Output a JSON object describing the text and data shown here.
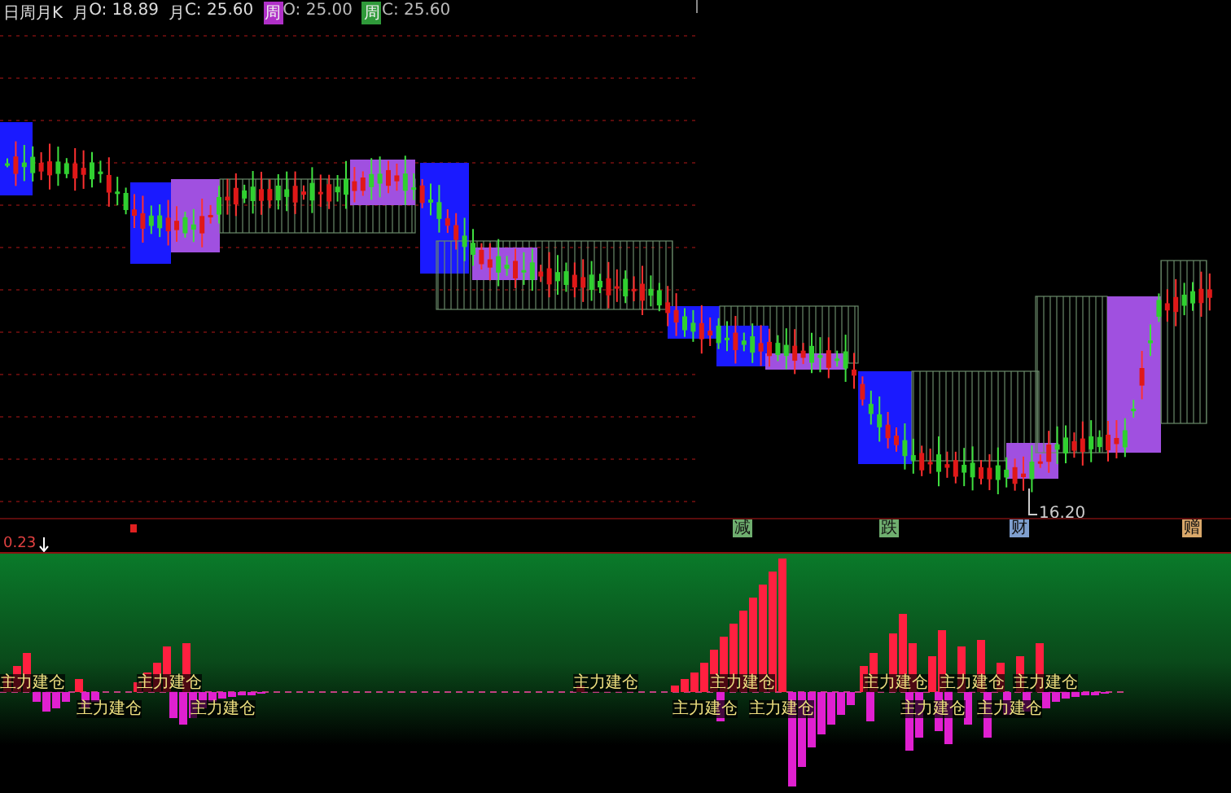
{
  "header": {
    "title": "日周月K",
    "items": [
      {
        "tag": "月",
        "text": "O: 18.89"
      },
      {
        "tag": "月",
        "text": "C: 25.60"
      },
      {
        "tag": "周",
        "text": "O: 25.00",
        "color": "#b030c8"
      },
      {
        "tag": "周",
        "text": "C: 25.60",
        "color": "#2f9a3a"
      }
    ]
  },
  "low_label": "16.20",
  "event_markers": [
    {
      "label": "减",
      "color": "#6fae6f"
    },
    {
      "label": "跌",
      "color": "#6fae6f"
    },
    {
      "label": "财",
      "color": "#7f9fcf"
    },
    {
      "label": "赠",
      "color": "#d9a86a"
    }
  ],
  "indicator": {
    "value": "0.23",
    "signals": [
      "主力建仓",
      "主力建仓",
      "主力建仓",
      "主力建仓",
      "主力建仓",
      "主力建仓",
      "主力建仓",
      "主力建仓",
      "主力建仓",
      "主力建仓",
      "主力建仓",
      "主力建仓",
      "主力建仓"
    ]
  }
}
